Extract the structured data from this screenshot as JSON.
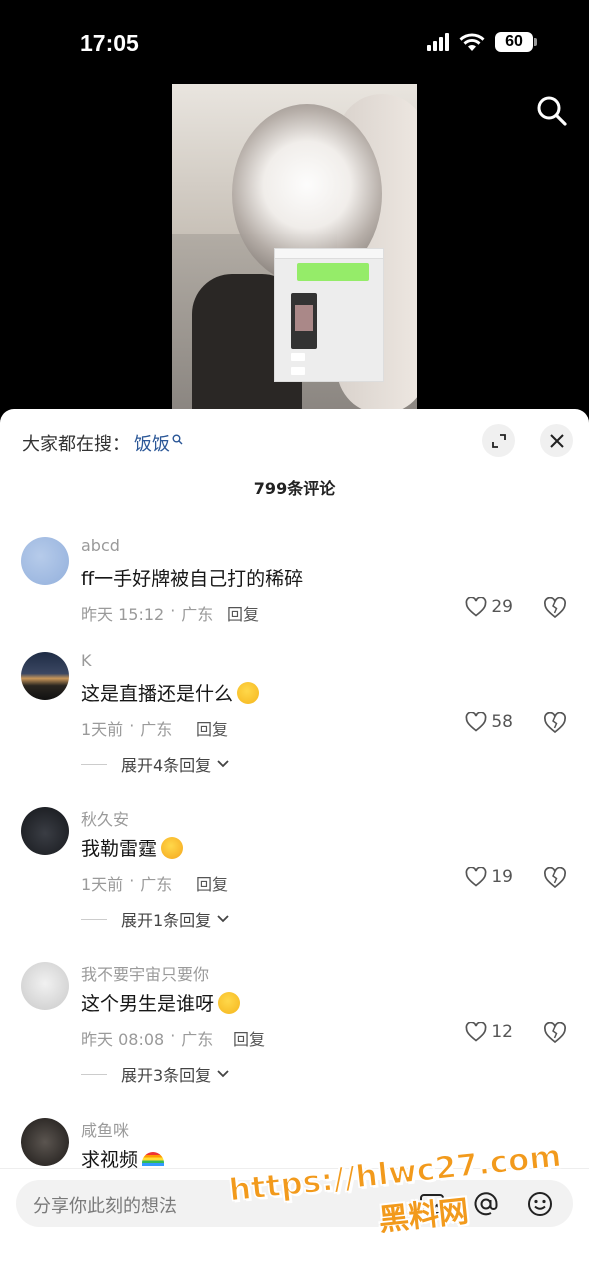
{
  "status_bar": {
    "time": "17:05",
    "battery": "60"
  },
  "search_hint": {
    "prefix": "大家都在搜：",
    "keyword": "饭饭"
  },
  "comment_count": "799条评论",
  "comments": [
    {
      "user": "abcd",
      "text": "ff一手好牌被自己打的稀碎",
      "time": "昨天 15:12",
      "location": "广东",
      "reply": "回复",
      "likes": "29",
      "expand": ""
    },
    {
      "user": "K",
      "text": "这是直播还是什么",
      "time": "1天前",
      "location": "广东",
      "reply": "回复",
      "likes": "58",
      "expand": "展开4条回复"
    },
    {
      "user": "秋久安",
      "text": "我勒雷霆",
      "time": "1天前",
      "location": "广东",
      "reply": "回复",
      "likes": "19",
      "expand": "展开1条回复"
    },
    {
      "user": "我不要宇宙只要你",
      "text": "这个男生是谁呀",
      "time": "昨天 08:08",
      "location": "广东",
      "reply": "回复",
      "likes": "12",
      "expand": "展开3条回复"
    },
    {
      "user": "咸鱼咪",
      "text": "求视频",
      "time": "",
      "location": "",
      "reply": "",
      "likes": "",
      "expand": ""
    }
  ],
  "input": {
    "placeholder": "分享你此刻的想法"
  },
  "watermark": {
    "url": "https://hlwc27.com",
    "name": "黑料网"
  },
  "colors": {
    "keyword": "#2b5797",
    "watermark": "#f29a1c"
  }
}
